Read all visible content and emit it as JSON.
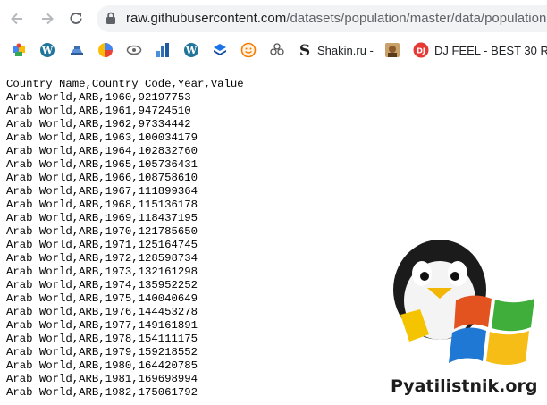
{
  "browser": {
    "url_host": "raw.githubusercontent.com",
    "url_path": "/datasets/population/master/data/population.csv"
  },
  "bookmarks": [
    {
      "icon": "puzzle-icon",
      "label": ""
    },
    {
      "icon": "wordpress-icon",
      "label": ""
    },
    {
      "icon": "hat-icon",
      "label": ""
    },
    {
      "icon": "circle-chart-icon",
      "label": ""
    },
    {
      "icon": "eye-icon",
      "label": ""
    },
    {
      "icon": "analytics-icon",
      "label": ""
    },
    {
      "icon": "wordpress-icon",
      "label": ""
    },
    {
      "icon": "layers-icon",
      "label": ""
    },
    {
      "icon": "smiley-icon",
      "label": ""
    },
    {
      "icon": "flower-icon",
      "label": ""
    },
    {
      "icon": "s-logo-icon",
      "label": "Shakin.ru -"
    },
    {
      "icon": "photo-icon",
      "label": ""
    },
    {
      "icon": "dj-icon",
      "label": "DJ FEEL - BEST 30 R..."
    }
  ],
  "csv": {
    "header": "Country Name,Country Code,Year,Value",
    "rows": [
      "Arab World,ARB,1960,92197753",
      "Arab World,ARB,1961,94724510",
      "Arab World,ARB,1962,97334442",
      "Arab World,ARB,1963,100034179",
      "Arab World,ARB,1964,102832760",
      "Arab World,ARB,1965,105736431",
      "Arab World,ARB,1966,108758610",
      "Arab World,ARB,1967,111899364",
      "Arab World,ARB,1968,115136178",
      "Arab World,ARB,1969,118437195",
      "Arab World,ARB,1970,121785650",
      "Arab World,ARB,1971,125164745",
      "Arab World,ARB,1972,128598734",
      "Arab World,ARB,1973,132161298",
      "Arab World,ARB,1974,135952252",
      "Arab World,ARB,1975,140040649",
      "Arab World,ARB,1976,144453278",
      "Arab World,ARB,1977,149161891",
      "Arab World,ARB,1978,154111175",
      "Arab World,ARB,1979,159218552",
      "Arab World,ARB,1980,164420785",
      "Arab World,ARB,1981,169698994",
      "Arab World,ARB,1982,175061792"
    ]
  },
  "watermark": {
    "text": "Pyatilistnik.org"
  }
}
